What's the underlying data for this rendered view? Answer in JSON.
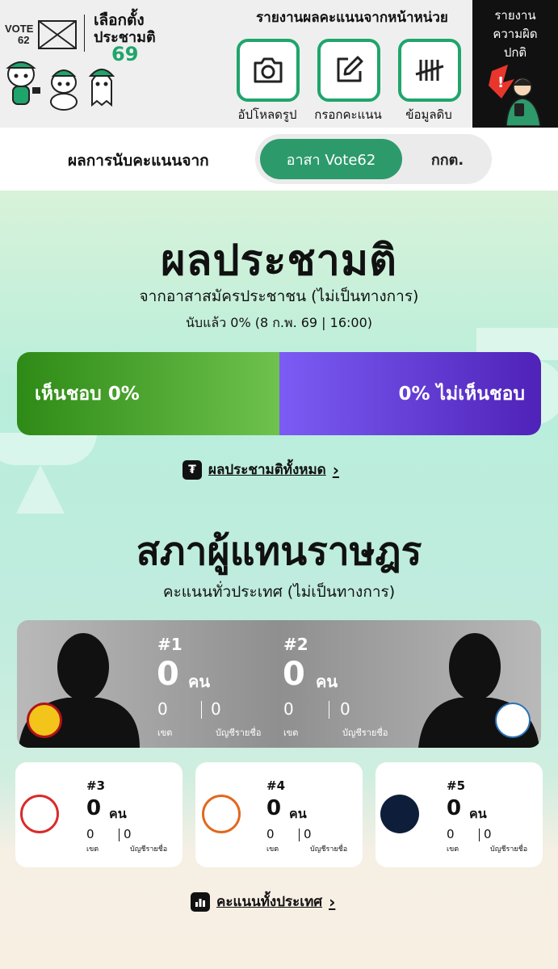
{
  "header": {
    "logo_vote": "VOTE62",
    "logo_election_line1": "เลือกตั้ง",
    "logo_election_line2": "ประชามติ",
    "logo_election_number": "69",
    "report_title": "รายงานผลคะแนนจากหน้าหน่วย",
    "actions": [
      {
        "label": "อัปโหลดรูป",
        "icon": "camera-icon"
      },
      {
        "label": "กรอกคะแนน",
        "icon": "edit-icon"
      },
      {
        "label": "ข้อมูลดิบ",
        "icon": "tally-icon"
      }
    ],
    "wrong_report": [
      "รายงาน",
      "ความผิด",
      "ปกติ"
    ]
  },
  "source": {
    "label": "ผลการนับคะแนนจาก",
    "options": [
      "อาสา Vote62",
      "กกต."
    ],
    "selected": "อาสา Vote62"
  },
  "referendum": {
    "title": "ผลประชามติ",
    "subtitle": "จากอาสาสมัครประชาชน (ไม่เป็นทางการ)",
    "counted": "นับแล้ว 0% (8 ก.พ. 69 | 16:00)",
    "agree_label": "เห็นชอบ 0%",
    "disagree_label": "0% ไม่เห็นชอบ",
    "agree_share": 0.5,
    "agree_color": "#4aa72d",
    "disagree_color": "#6a3fe0",
    "all_link": "ผลประชามติทั้งหมด"
  },
  "house": {
    "title": "สภาผู้แทนราษฎร",
    "subtitle": "คะแนนทั่วประเทศ (ไม่เป็นทางการ)",
    "unit": "คน",
    "district_label": "เขต",
    "list_label": "บัญชีรายชื่อ",
    "parties": [
      {
        "rank": "#1",
        "seats": "0",
        "district": "0",
        "list": "0"
      },
      {
        "rank": "#2",
        "seats": "0",
        "district": "0",
        "list": "0"
      },
      {
        "rank": "#3",
        "seats": "0",
        "district": "0",
        "list": "0"
      },
      {
        "rank": "#4",
        "seats": "0",
        "district": "0",
        "list": "0"
      },
      {
        "rank": "#5",
        "seats": "0",
        "district": "0",
        "list": "0"
      }
    ],
    "all_link": "คะแนนทั้งประเทศ"
  },
  "colors": {
    "brand_green": "#1fa56b",
    "toggle_active": "#2d9a6b"
  }
}
